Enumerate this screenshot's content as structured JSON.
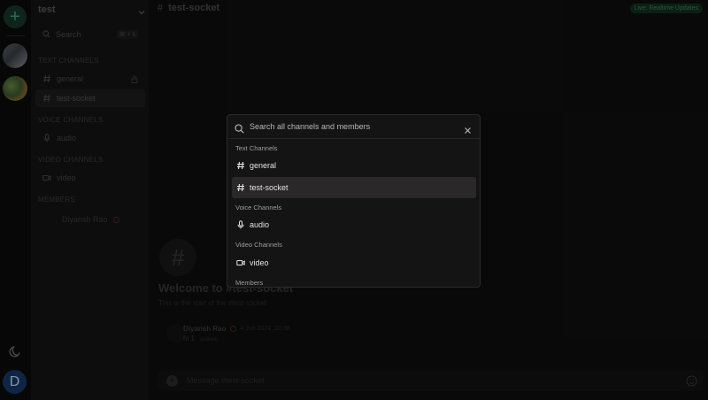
{
  "server": {
    "name": "test",
    "search_label": "Search",
    "search_shortcut": "⌘ + k"
  },
  "sidebar": {
    "text_section": "TEXT CHANNELS",
    "voice_section": "VOICE CHANNELS",
    "video_section": "VIDEO CHANNELS",
    "members_section": "MEMBERS",
    "text_channels": [
      {
        "label": "general",
        "icon": "hash-icon",
        "locked": true
      },
      {
        "label": "test-socket",
        "icon": "hash-icon",
        "active": true
      }
    ],
    "voice_channels": [
      {
        "label": "audio",
        "icon": "mic-icon"
      }
    ],
    "video_channels": [
      {
        "label": "video",
        "icon": "video-icon"
      }
    ],
    "members": [
      {
        "name": "Diyansh Rao"
      }
    ]
  },
  "rail": {
    "avatar_initial": "D"
  },
  "main": {
    "channel_title": "test-socket",
    "live_badge": "Live: Realtime Updates",
    "welcome_title": "Welcome to #test-socket",
    "welcome_sub": "This is the start of the #test-socket",
    "message": {
      "author": "Diyansh Rao",
      "time": "4 Jun 2024, 20:38",
      "text": "hi 1",
      "edited": "(edited)"
    },
    "composer_placeholder": "Message #test-socket"
  },
  "palette": {
    "placeholder": "Search all channels and members",
    "groups": {
      "text": "Text Channels",
      "voice": "Voice Channels",
      "video": "Video Channels",
      "members": "Members"
    },
    "items": {
      "general": "general",
      "test_socket": "test-socket",
      "audio": "audio",
      "video": "video"
    },
    "selected": "test-socket"
  },
  "colors": {
    "accent_green": "#3fae7a",
    "live_badge_bg": "#13301f",
    "avatar_blue": "#143b6b",
    "selected_item": "#2a2828"
  }
}
